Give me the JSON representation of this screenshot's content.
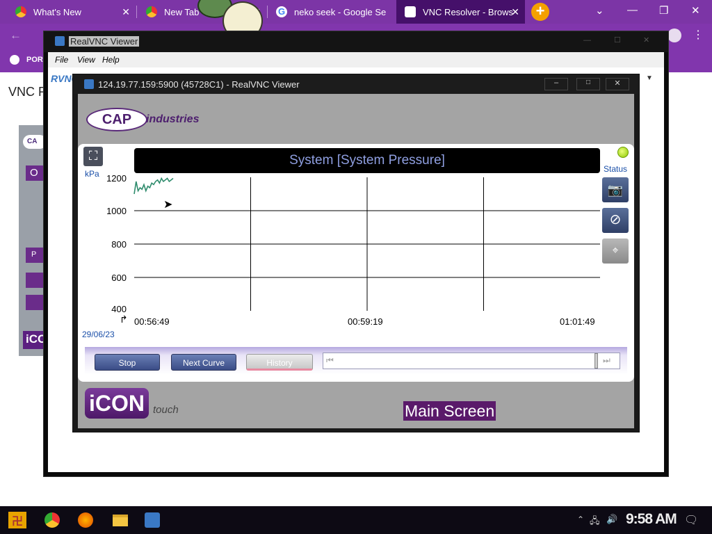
{
  "browser": {
    "tabs": [
      {
        "title": "What's New",
        "icon": "chrome-icon"
      },
      {
        "title": "New Tab",
        "icon": "chrome-icon"
      },
      {
        "title": "neko seek - Google Se",
        "icon": "google-icon"
      },
      {
        "title": "VNC Resolver - Brows",
        "icon": "vnc-icon"
      }
    ],
    "new_tab_symbol": "+",
    "bookmark": "POR",
    "page_heading": "VNC Re",
    "page_side_items": [
      "CA",
      "O",
      "P"
    ],
    "page_logo": "iCO",
    "accent": "#7c35a6"
  },
  "outer_window": {
    "title": "RealVNC Viewer",
    "menu": [
      "File",
      "View",
      "Help"
    ],
    "brand": "RVNC"
  },
  "inner_window": {
    "title": "124.19.77.159:5900 (45728C1) - RealVNC Viewer"
  },
  "hmi": {
    "logo_cap": "CAP",
    "logo_industries": "industries",
    "chart_title": "System [System Pressure]",
    "unit": "kPa",
    "status_label": "Status",
    "date": "29/06/23",
    "buttons": {
      "stop": "Stop",
      "next_curve": "Next Curve",
      "history": "History"
    },
    "brand_icon": "iCON",
    "brand_touch": "touch",
    "screen_name": "Main Screen"
  },
  "chart_data": {
    "type": "line",
    "title": "System [System Pressure]",
    "ylabel": "kPa",
    "ylim": [
      400,
      1200
    ],
    "yticks": [
      1200,
      1000,
      800,
      600,
      400
    ],
    "xticks": [
      "00:56:49",
      "00:59:19",
      "01:01:49"
    ],
    "x": [
      "00:56:49",
      "00:56:52",
      "00:56:55",
      "00:56:58",
      "00:57:01",
      "00:57:04",
      "00:57:07",
      "00:57:10",
      "00:57:13",
      "00:57:16",
      "00:57:19",
      "00:57:22",
      "00:57:25",
      "00:57:28",
      "00:57:31",
      "00:57:34",
      "00:57:37",
      "00:57:40",
      "00:57:43",
      "00:57:46",
      "00:57:49"
    ],
    "series": [
      {
        "values": [
          1160,
          1200,
          1170,
          1180,
          1175,
          1190,
          1170,
          1185,
          1180,
          1195,
          1190,
          1200,
          1205,
          1195,
          1210,
          1200,
          1205,
          1210,
          1200,
          1205,
          1210
        ],
        "color": "#2e8b6c"
      }
    ],
    "grid": true
  },
  "taskbar": {
    "clock": "9:58 AM"
  }
}
